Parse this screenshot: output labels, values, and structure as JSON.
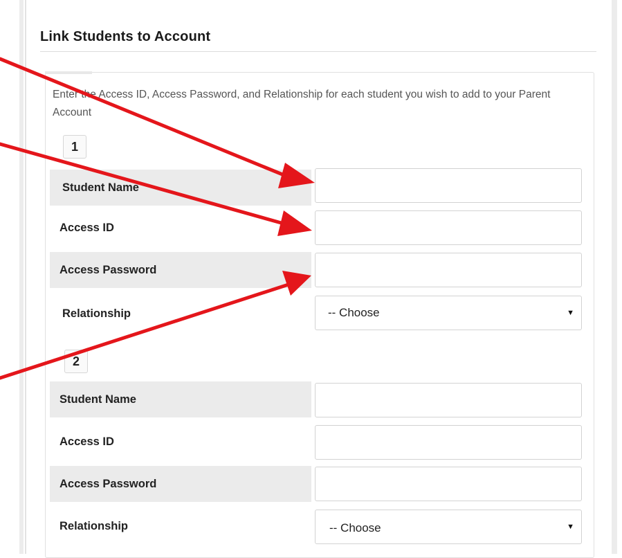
{
  "page": {
    "title": "Link Students to Account",
    "intro": "Enter the Access ID, Access Password, and Relationship for each student you wish to add to your Parent Account"
  },
  "students": [
    {
      "number": "1",
      "student_name_label": "Student Name",
      "access_id_label": "Access ID",
      "access_password_label": "Access Password",
      "relationship_label": "Relationship",
      "student_name_value": "",
      "access_id_value": "",
      "access_password_value": "",
      "relationship_value": "-- Choose"
    },
    {
      "number": "2",
      "student_name_label": "Student Name",
      "access_id_label": "Access ID",
      "access_password_label": "Access Password",
      "relationship_label": "Relationship",
      "student_name_value": "",
      "access_id_value": "",
      "access_password_value": "",
      "relationship_value": "-- Choose"
    }
  ],
  "icons": {
    "select_caret": "triangle-down-icon",
    "annotation": "red-arrow-icon"
  },
  "colors": {
    "annotation_arrow": "#e4161b",
    "shaded_row": "#ebebeb",
    "border": "#d2d2d2"
  }
}
